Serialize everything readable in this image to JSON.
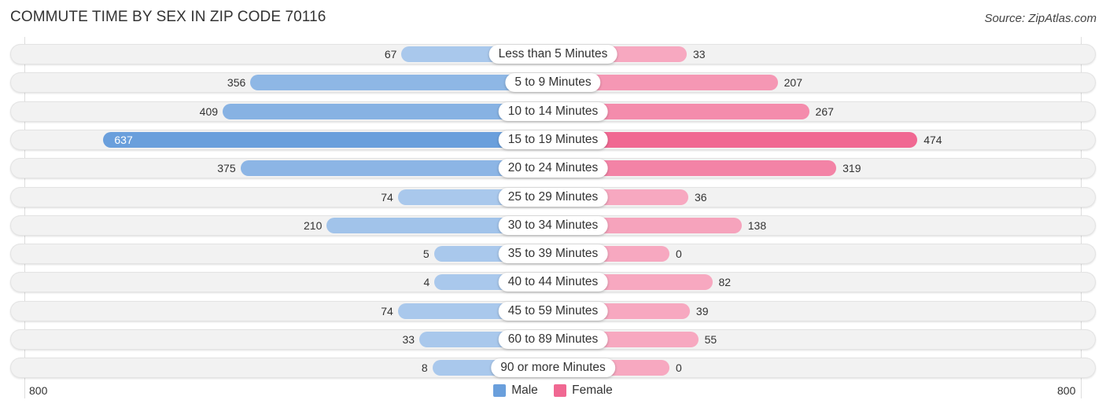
{
  "header": {
    "title": "COMMUTE TIME BY SEX IN ZIP CODE 70116",
    "source": "Source: ZipAtlas.com"
  },
  "colors": {
    "male_strong": "#6a9fdc",
    "male_light": "#a9c8ec",
    "female_strong": "#f06892",
    "female_light": "#f7a8c0"
  },
  "chart_data": {
    "type": "bar",
    "orientation": "horizontal-diverging",
    "title": "COMMUTE TIME BY SEX IN ZIP CODE 70116",
    "categories": [
      "Less than 5 Minutes",
      "5 to 9 Minutes",
      "10 to 14 Minutes",
      "15 to 19 Minutes",
      "20 to 24 Minutes",
      "25 to 29 Minutes",
      "30 to 34 Minutes",
      "35 to 39 Minutes",
      "40 to 44 Minutes",
      "45 to 59 Minutes",
      "60 to 89 Minutes",
      "90 or more Minutes"
    ],
    "series": [
      {
        "name": "Male",
        "side": "left",
        "values": [
          67,
          356,
          409,
          637,
          375,
          74,
          210,
          5,
          4,
          74,
          33,
          8
        ]
      },
      {
        "name": "Female",
        "side": "right",
        "values": [
          33,
          207,
          267,
          474,
          319,
          36,
          138,
          0,
          82,
          39,
          55,
          0
        ]
      }
    ],
    "axis": {
      "left_max_label": "800",
      "right_max_label": "800",
      "range": [
        0,
        800
      ]
    },
    "legend": {
      "position": "bottom-center",
      "entries": [
        "Male",
        "Female"
      ]
    },
    "xlabel": "",
    "ylabel": ""
  }
}
